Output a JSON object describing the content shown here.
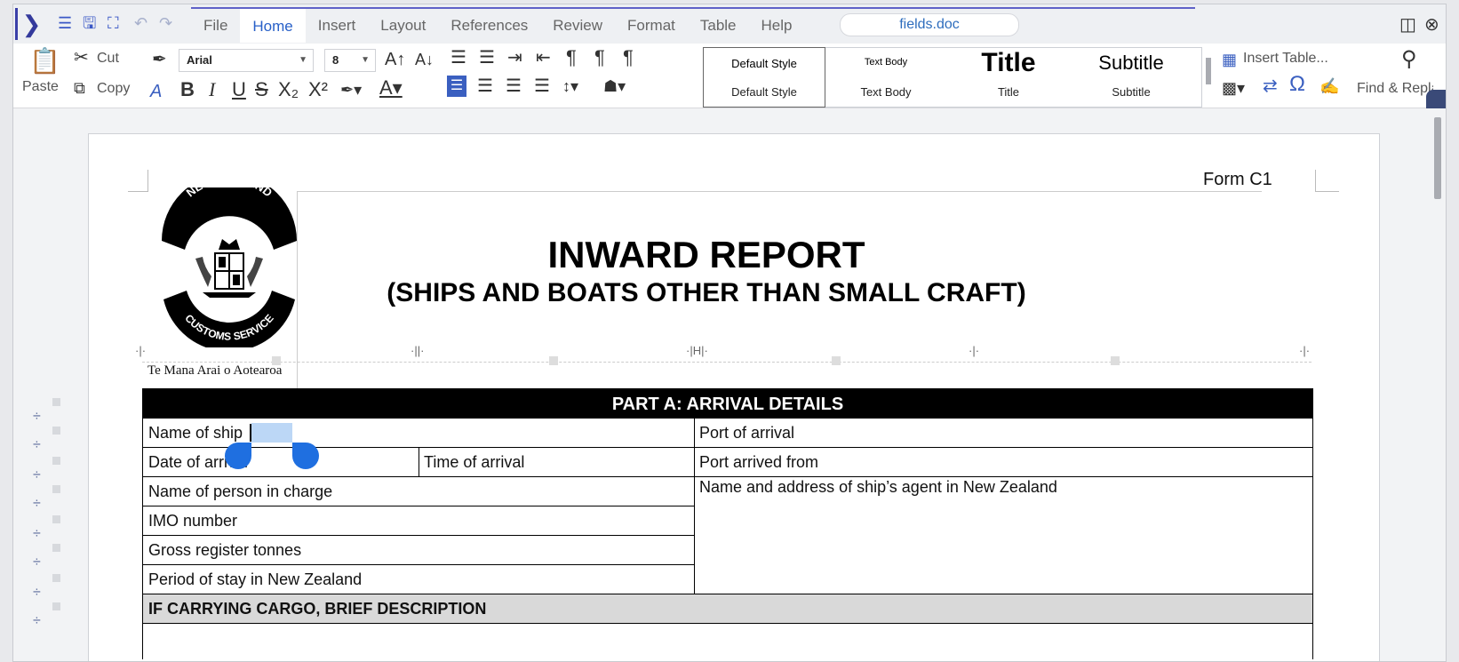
{
  "quick_toolbar": {
    "icons": [
      "hamburger-icon",
      "save-icon",
      "fullscreen-icon",
      "undo-icon",
      "redo-icon"
    ]
  },
  "menu": {
    "items": [
      "File",
      "Home",
      "Insert",
      "Layout",
      "References",
      "Review",
      "Format",
      "Table",
      "Help"
    ],
    "active": "Home"
  },
  "document_name": "fields.doc",
  "ribbon": {
    "paste_label": "Paste",
    "cut_label": "Cut",
    "copy_label": "Copy",
    "font_name": "Arial",
    "font_size": "8",
    "styles": [
      {
        "preview": "Default Style",
        "name": "Default Style"
      },
      {
        "preview": "Text Body",
        "name": "Text Body"
      },
      {
        "preview": "Title",
        "name": "Title"
      },
      {
        "preview": "Subtitle",
        "name": "Subtitle"
      }
    ],
    "insert_table_label": "Insert Table...",
    "find_replace_label": "Find & Replace"
  },
  "document": {
    "form_code": "Form C1",
    "title": "INWARD REPORT",
    "subtitle": "(SHIPS AND BOATS OTHER THAN SMALL CRAFT)",
    "seal": {
      "top_text": "NEW ZEALAND",
      "bottom_text": "CUSTOMS SERVICE"
    },
    "maori_text": "Te Mana Arai o Aotearoa",
    "part_a_header": "PART A: ARRIVAL DETAILS",
    "fields": {
      "name_of_ship": "Name of ship",
      "port_of_arrival": "Port of arrival",
      "date_of_arrival": "Date of arrival",
      "time_of_arrival": "Time of arrival",
      "port_arrived_from": "Port arrived from",
      "person_in_charge": "Name of person in charge",
      "agent": "Name and address of ship’s agent in New Zealand",
      "imo_number": "IMO number",
      "gross_tonnes": "Gross register tonnes",
      "period_of_stay": "Period of stay in New Zealand"
    },
    "cargo_header": "IF CARRYING CARGO, BRIEF DESCRIPTION"
  }
}
